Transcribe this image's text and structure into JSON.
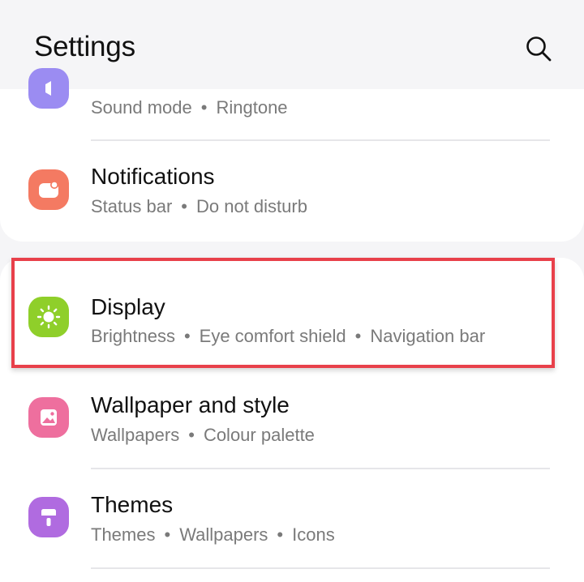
{
  "header": {
    "title": "Settings",
    "search_icon": "search-icon"
  },
  "items": [
    {
      "label": "",
      "subtitle_parts": [
        "Sound mode",
        "Ringtone"
      ],
      "icon": "sound-icon",
      "icon_color": "#9b8cf2"
    },
    {
      "label": "Notifications",
      "subtitle_parts": [
        "Status bar",
        "Do not disturb"
      ],
      "icon": "notifications-icon",
      "icon_color": "#f47a62"
    },
    {
      "label": "Display",
      "subtitle_parts": [
        "Brightness",
        "Eye comfort shield",
        "Navigation bar"
      ],
      "icon": "display-brightness-icon",
      "icon_color": "#8fcf2a",
      "highlighted": true
    },
    {
      "label": "Wallpaper and style",
      "subtitle_parts": [
        "Wallpapers",
        "Colour palette"
      ],
      "icon": "wallpaper-icon",
      "icon_color": "#ee6f9e"
    },
    {
      "label": "Themes",
      "subtitle_parts": [
        "Themes",
        "Wallpapers",
        "Icons"
      ],
      "icon": "themes-brush-icon",
      "icon_color": "#b06be0"
    }
  ],
  "colors": {
    "background": "#f5f5f7",
    "card": "#ffffff",
    "highlight_border": "#e8404a",
    "subtitle_text": "#7a7a7a"
  }
}
